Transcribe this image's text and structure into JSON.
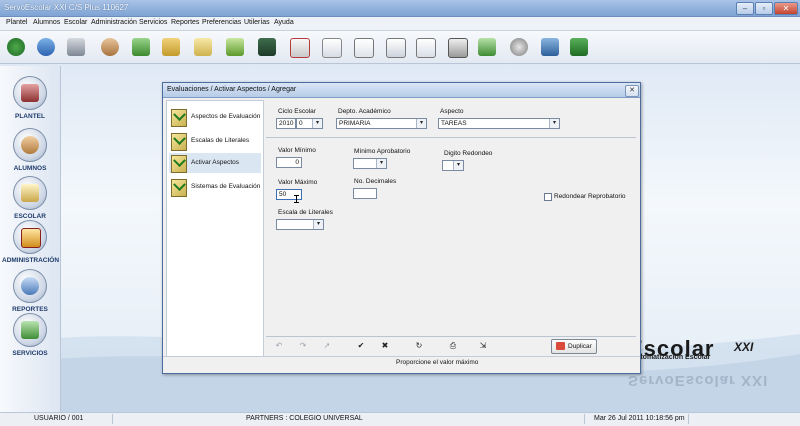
{
  "app": {
    "title": "ServoEscolar XXI C/S Plus  110627"
  },
  "menu": [
    "Plantel",
    "Alumnos",
    "Escolar",
    "Administración",
    "Servicios",
    "Reportes",
    "Preferencias",
    "Utilerías",
    "Ayuda"
  ],
  "toolbar": {
    "icons": [
      "refresh-icon",
      "database-icon",
      "users-icon",
      "teacher-icon",
      "group-icon",
      "book-icon",
      "pen-icon",
      "classroom-icon",
      "checklist-icon",
      "note-icon",
      "document-icon",
      "documents-icon",
      "report-icon",
      "calculator-icon",
      "money-icon",
      "money-bag-icon",
      "edit-icon",
      "exit-icon"
    ]
  },
  "nav": [
    {
      "label": "PLANTEL",
      "icon": "school-icon"
    },
    {
      "label": "ALUMNOS",
      "icon": "students-icon"
    },
    {
      "label": "ESCOLAR",
      "icon": "grades-icon"
    },
    {
      "label": "ADMINISTRACIÓN",
      "icon": "money-icon"
    },
    {
      "label": "REPORTES",
      "icon": "reports-icon"
    },
    {
      "label": "SERVICIOS",
      "icon": "services-icon"
    }
  ],
  "brand": {
    "name": "Escolar",
    "suffix": "XXI",
    "tagline": "Automatización Escolar",
    "mirror": "ServoEscolar XXI"
  },
  "dialog": {
    "title": "Evaluaciones / Activar Aspectos / Agregar",
    "close": "✕",
    "tabs": [
      {
        "label": "Aspectos de Evaluación",
        "selected": false
      },
      {
        "label": "Escalas de Literales",
        "selected": false
      },
      {
        "label": "Activar Aspectos",
        "selected": true
      },
      {
        "label": "Sistemas de Evaluación",
        "selected": false
      }
    ],
    "fields": {
      "ciclo_label": "Ciclo Escolar",
      "ciclo_year": "2010",
      "ciclo_num": "0",
      "depto_label": "Depto. Académico",
      "depto_value": "PRIMARIA",
      "aspecto_label": "Aspecto",
      "aspecto_value": "TAREAS",
      "valor_min_label": "Valor Mínimo",
      "valor_min_value": "0",
      "min_aprob_label": "Mínimo Aprobatorio",
      "min_aprob_value": "",
      "digito_label": "Digito Redondeo",
      "digito_value": "",
      "valor_max_label": "Valor Máximo",
      "valor_max_value": "50",
      "no_dec_label": "No. Decimales",
      "no_dec_value": "",
      "redondear_label": "Redondear Reprobatorio",
      "escala_label": "Escala de Literales",
      "escala_value": ""
    },
    "buttons": {
      "duplicar": "Duplicar"
    },
    "status": "Proporcione el valor máximo"
  },
  "statusbar": {
    "user": "USUARIO / 001",
    "partners": "PARTNERS : COLEGIO UNIVERSAL",
    "datetime": "Mar 26 Jul 2011  10:18:56 pm"
  },
  "colors": {
    "accent": "#4b6c9c",
    "title_gradient": "#7ea3d4",
    "nav_label": "#1e3b6b"
  }
}
